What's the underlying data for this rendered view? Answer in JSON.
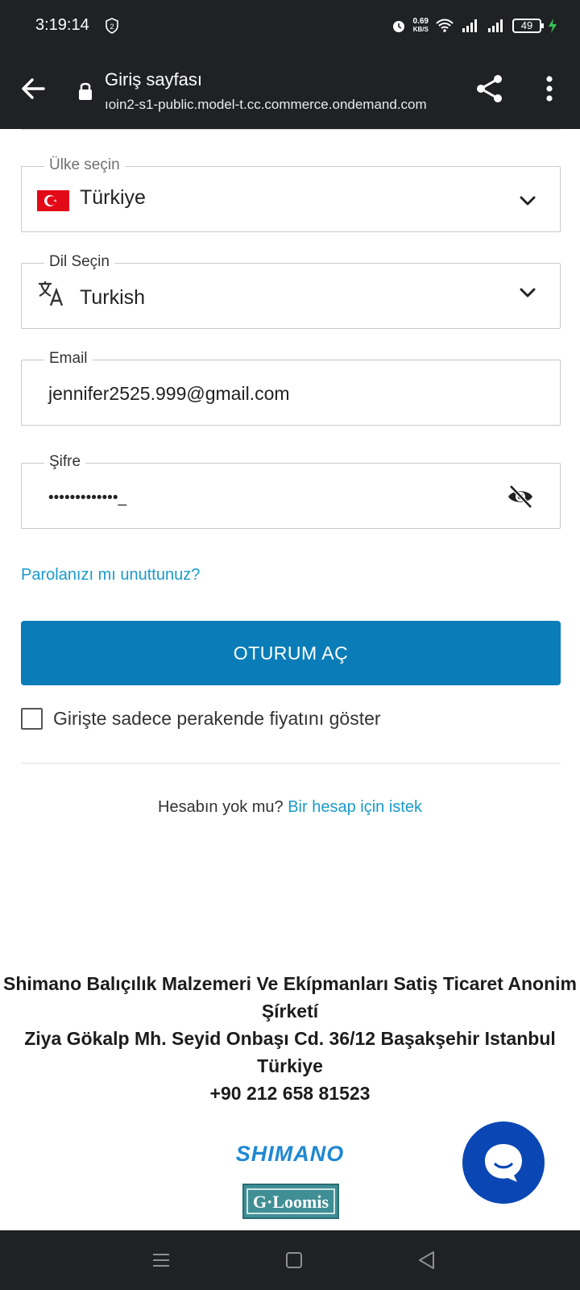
{
  "status_bar": {
    "time": "3:19:14",
    "notification_count": "2",
    "speed_value": "0.69",
    "speed_unit": "KB/S",
    "battery": "49"
  },
  "app_bar": {
    "title": "Giriş sayfası",
    "url": "ıoin2-s1-public.model-t.cc.commerce.ondemand.com"
  },
  "form": {
    "country": {
      "label": "Ülke seçin",
      "value": "Türkiye"
    },
    "language": {
      "label": "Dil Seçin",
      "value": "Turkish"
    },
    "email": {
      "label": "Email",
      "value": "jennifer2525.999@gmail.com"
    },
    "password": {
      "label": "Şifre",
      "value": "•••••••••••••_"
    },
    "forgot_link": "Parolanızı mı unuttunuz?",
    "login_button": "OTURUM AÇ",
    "retail_checkbox_label": "Girişte sadece perakende fiyatını göster",
    "retail_checkbox_checked": false
  },
  "signup": {
    "prompt": "Hesabın yok mu?",
    "link": "Bir hesap için istek"
  },
  "footer": {
    "company_line1": "Shimano Balıçılık Malzemeri Ve Ekípmanları Satiş Ticaret Anonim",
    "company_line2": "Şírketí",
    "address_line1": "Ziya Gökalp Mh. Seyid Onbaşı Cd. 36/12 Başakşehir Istanbul",
    "address_line2": "Türkiye",
    "phone": "+90 212 658 81523",
    "logo_shimano": "SHIMANO",
    "logo_gloomis": "G·Loomis"
  },
  "colors": {
    "system_bar": "#202124",
    "primary_button": "#0a7db8",
    "link": "#1a9acb",
    "chat_bubble": "#0a47b5",
    "flag_red": "#e30a17"
  },
  "icons": {
    "back": "arrow-left-icon",
    "lock": "lock-icon",
    "share": "share-icon",
    "menu": "more-vert-icon",
    "chevron": "chevron-down-icon",
    "translate": "translate-icon",
    "visibility": "visibility-off-icon",
    "chat": "chat-icon"
  }
}
